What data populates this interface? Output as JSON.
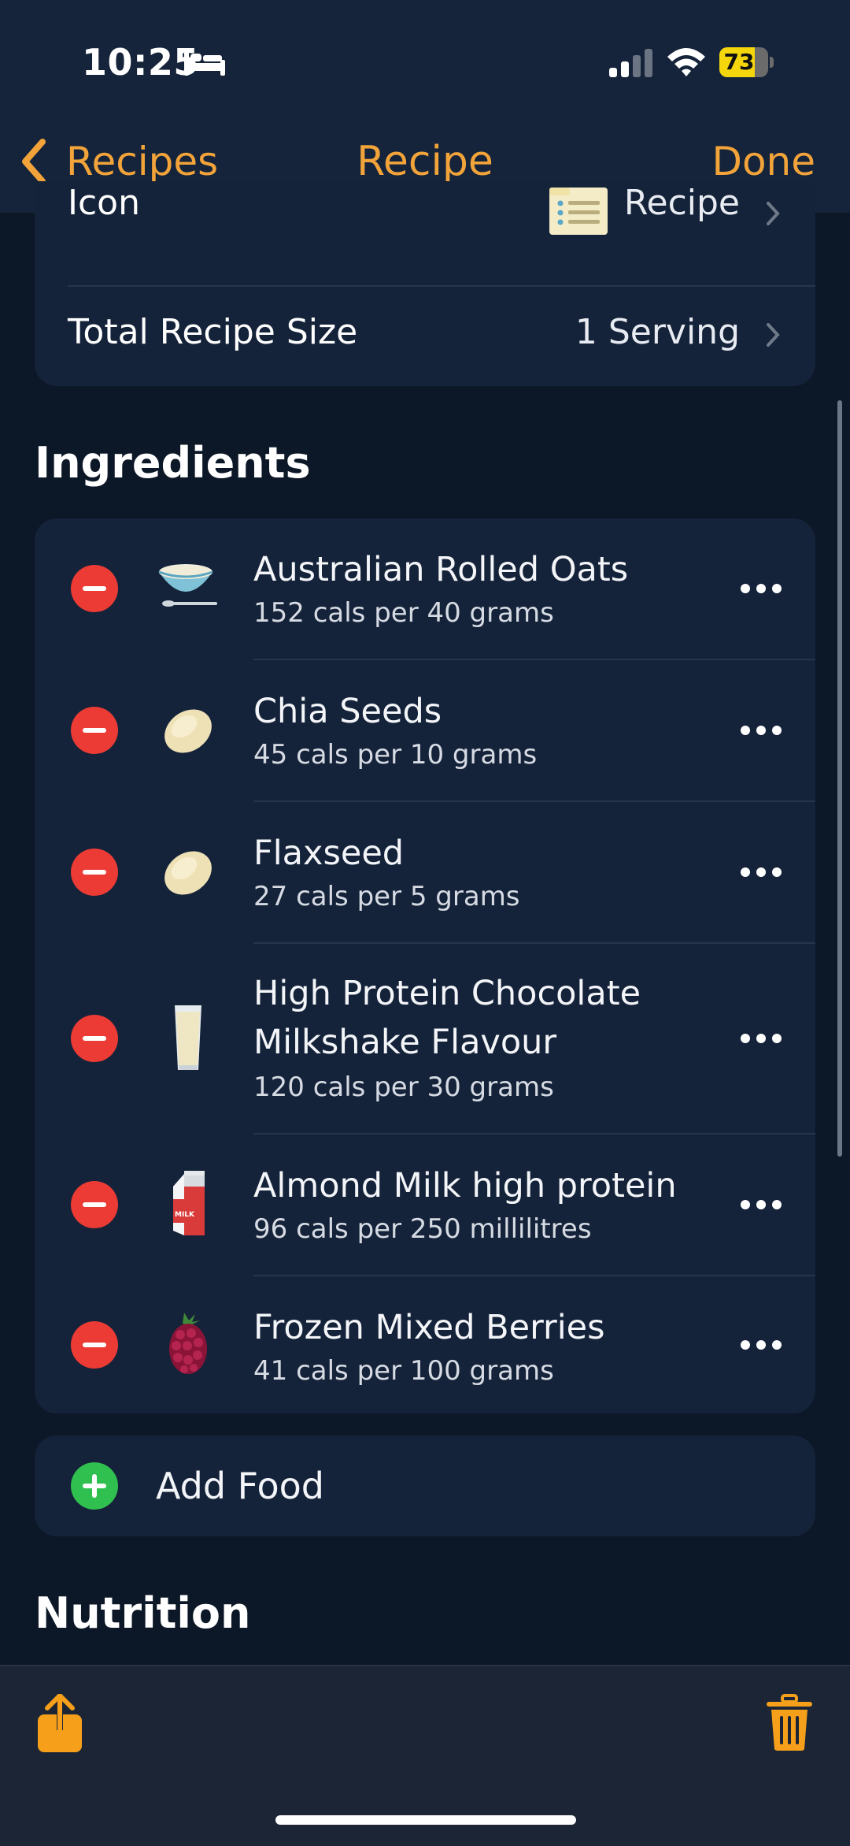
{
  "status_bar": {
    "time": "10:25",
    "battery": "73",
    "battery_level": 0.73
  },
  "nav": {
    "back_label": "Recipes",
    "title": "Recipe",
    "done_label": "Done"
  },
  "settings": {
    "icon_label": "Icon",
    "icon_value": "Recipe",
    "size_label": "Total Recipe Size",
    "size_value": "1 Serving"
  },
  "ingredients_header": "Ingredients",
  "ingredients": [
    {
      "name": "Australian Rolled Oats",
      "detail": "152 cals per 40 grams",
      "icon": "oats-bowl-icon"
    },
    {
      "name": "Chia Seeds",
      "detail": "45 cals per 10 grams",
      "icon": "seed-icon"
    },
    {
      "name": "Flaxseed",
      "detail": "27 cals per 5 grams",
      "icon": "seed-icon"
    },
    {
      "name_line1": "High Protein Chocolate",
      "name_line2": "Milkshake Flavour",
      "detail": "120 cals per 30 grams",
      "icon": "milkshake-glass-icon"
    },
    {
      "name": "Almond Milk high protein",
      "detail": "96 cals per 250 millilitres",
      "icon": "milk-carton-icon",
      "carton_text": "MILK"
    },
    {
      "name": "Frozen Mixed Berries",
      "detail": "41 cals per 100 grams",
      "icon": "berry-icon"
    }
  ],
  "add_food_label": "Add Food",
  "nutrition_header": "Nutrition",
  "colors": {
    "accent": "#f2a33a",
    "delete": "#eb3b34",
    "add": "#30c04f",
    "background": "#0c1727",
    "card": "#15233a"
  },
  "toolbar": {
    "left_icon": "share-icon",
    "right_icon": "trash-icon"
  }
}
